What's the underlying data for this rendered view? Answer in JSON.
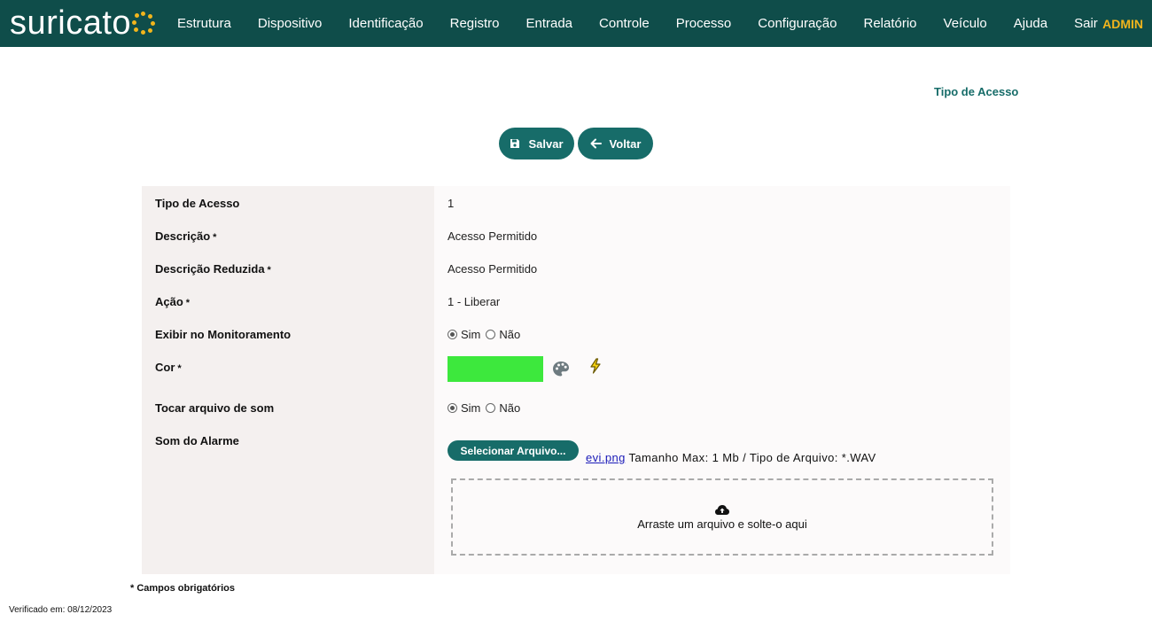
{
  "brand": {
    "logo_text": "suricato"
  },
  "nav": {
    "items": [
      "Estrutura",
      "Dispositivo",
      "Identificação",
      "Registro",
      "Entrada",
      "Controle",
      "Processo",
      "Configuração",
      "Relatório",
      "Veículo",
      "Ajuda",
      "Sair"
    ],
    "user": "ADMIN"
  },
  "page": {
    "title": "Tipo de Acesso"
  },
  "toolbar": {
    "save_label": "Salvar",
    "back_label": "Voltar"
  },
  "form": {
    "required_mark": "*",
    "fields": {
      "tipo_acesso": {
        "label": "Tipo de Acesso",
        "value": "1"
      },
      "descricao": {
        "label": "Descrição",
        "value": "Acesso Permitido"
      },
      "descricao_reduzida": {
        "label": "Descrição Reduzida",
        "value": "Acesso Permitido"
      },
      "acao": {
        "label": "Ação",
        "value": "1 - Liberar"
      },
      "exibir_monitoramento": {
        "label": "Exibir no Monitoramento",
        "options": [
          "Sim",
          "Não"
        ],
        "selected": "Sim"
      },
      "cor": {
        "label": "Cor",
        "value_color": "#3de83d"
      },
      "tocar_som": {
        "label": "Tocar arquivo de som",
        "options": [
          "Sim",
          "Não"
        ],
        "selected": "Sim"
      },
      "som_alarme": {
        "label": "Som do Alarme",
        "select_button": "Selecionar Arquivo...",
        "file_name": "evi.png",
        "file_hint": "Tamanho Max: 1 Mb / Tipo de Arquivo: *.WAV",
        "dropzone_text": "Arraste um arquivo e solte-o aqui"
      }
    }
  },
  "footer": {
    "required_note": "* Campos obrigatórios",
    "verified": "Verificado em: 08/12/2023"
  },
  "colors": {
    "header_bg": "#0f4d4a",
    "accent": "#176c69",
    "user": "#f2b51c"
  }
}
